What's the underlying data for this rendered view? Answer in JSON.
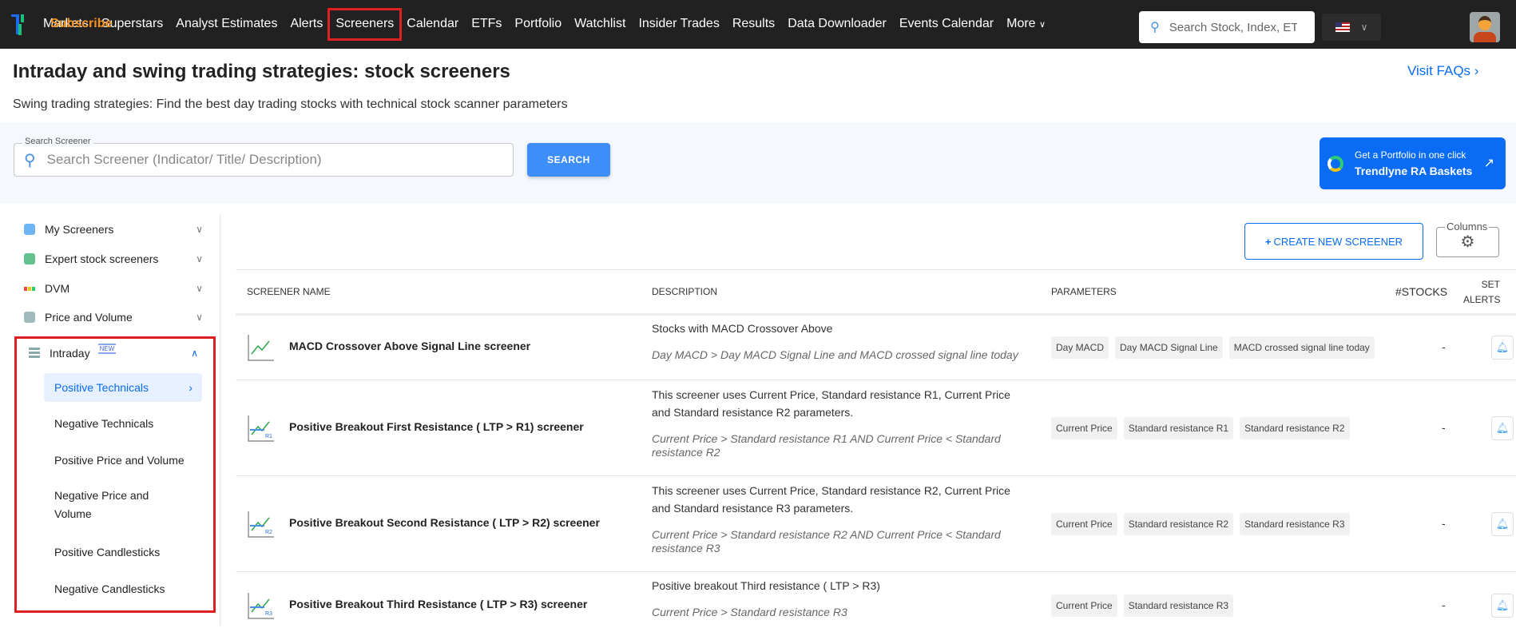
{
  "nav": {
    "items": [
      "Markets",
      "Superstars",
      "Analyst Estimates",
      "Alerts",
      "Screeners",
      "Subscribe",
      "Calendar",
      "ETFs",
      "Portfolio",
      "Watchlist",
      "Insider Trades",
      "Results",
      "Data Downloader",
      "Events Calendar",
      "More"
    ],
    "selected": "Screeners",
    "search_placeholder": "Search Stock, Index, ETF"
  },
  "page": {
    "title": "Intraday and swing trading strategies: stock screeners",
    "subtitle": "Swing trading strategies: Find the best day trading stocks with technical stock scanner parameters",
    "faq": "Visit FAQs"
  },
  "search": {
    "label": "Search Screener",
    "placeholder": "Search Screener (Indicator/ Title/ Description)",
    "button": "SEARCH"
  },
  "banner": {
    "line1": "Get a Portfolio in one click",
    "line2": "Trendlyne RA Baskets"
  },
  "sidebar": {
    "groups": [
      "My Screeners",
      "Expert stock screeners",
      "DVM",
      "Price and Volume"
    ],
    "intraday": {
      "label": "Intraday",
      "badge": "NEW",
      "items": [
        "Positive Technicals",
        "Negative Technicals",
        "Positive Price and Volume",
        "Negative Price and Volume",
        "Positive Candlesticks",
        "Negative Candlesticks"
      ]
    }
  },
  "toolbar": {
    "create": "CREATE NEW SCREENER",
    "columns": "Columns"
  },
  "table": {
    "headers": {
      "name": "SCREENER NAME",
      "desc": "DESCRIPTION",
      "params": "PARAMETERS",
      "stocks": "#STOCKS",
      "alerts_1": "SET",
      "alerts_2": "ALERTS"
    },
    "rows": [
      {
        "name": "MACD Crossover Above Signal Line screener",
        "desc": "Stocks with MACD Crossover Above",
        "formula": "Day MACD > Day MACD Signal Line and MACD crossed signal line today",
        "params": [
          "Day MACD",
          "Day MACD Signal Line",
          "MACD crossed signal line today"
        ],
        "stocks": "-",
        "badge": ""
      },
      {
        "name": "Positive Breakout First Resistance ( LTP > R1) screener",
        "desc": "This screener uses Current Price, Standard resistance R1, Current Price and Standard resistance R2 parameters.",
        "formula": "Current Price > Standard resistance R1 AND Current Price < Standard resistance R2",
        "params": [
          "Current Price",
          "Standard resistance R1",
          "Standard resistance R2"
        ],
        "stocks": "-",
        "badge": "R1"
      },
      {
        "name": "Positive Breakout Second Resistance ( LTP > R2) screener",
        "desc": "This screener uses Current Price, Standard resistance R2, Current Price and Standard resistance R3 parameters.",
        "formula": "Current Price > Standard resistance R2 AND Current Price < Standard resistance R3",
        "params": [
          "Current Price",
          "Standard resistance R2",
          "Standard resistance R3"
        ],
        "stocks": "-",
        "badge": "R2"
      },
      {
        "name": "Positive Breakout Third Resistance ( LTP > R3) screener",
        "desc": "Positive breakout Third resistance ( LTP > R3)",
        "formula": "Current Price > Standard resistance R3",
        "params": [
          "Current Price",
          "Standard resistance R3"
        ],
        "stocks": "-",
        "badge": "R3"
      }
    ]
  }
}
